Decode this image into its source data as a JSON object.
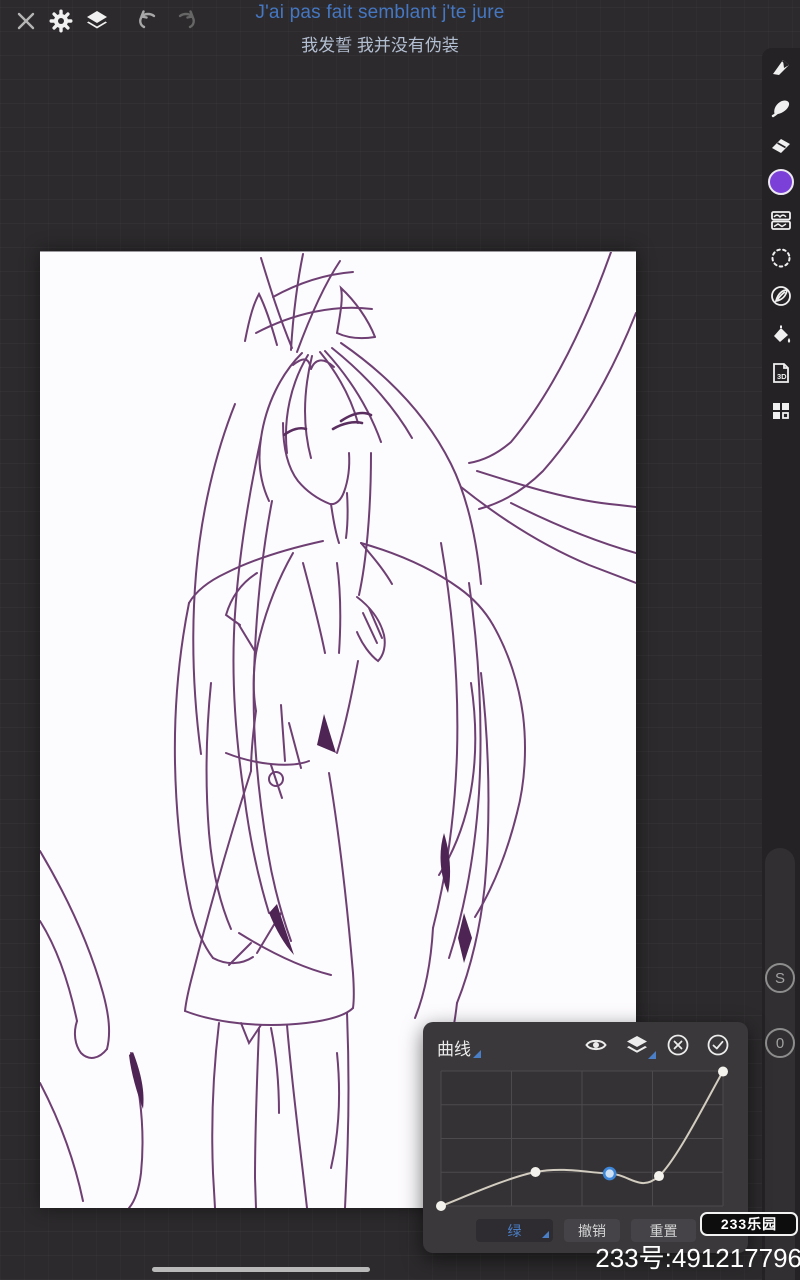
{
  "header": {
    "title_fr": "J'ai pas fait semblant j'te jure",
    "title_zh": "我发誓 我并没有伪装",
    "toolbar_icons": [
      "close-icon",
      "gear-icon",
      "layers-icon",
      "undo-icon",
      "redo-icon"
    ]
  },
  "right_toolbar": {
    "tools": [
      "brush-tool",
      "smudge-tool",
      "eraser-tool",
      "color-swatch",
      "adjustments-tool",
      "lasso-tool",
      "vector-tool",
      "fill-bucket-tool",
      "3d-tool",
      "pixel-grid-tool"
    ],
    "color_swatch_hex": "#7b40d8",
    "stabilizer_label": "S",
    "opacity_label": "0"
  },
  "curves_panel": {
    "title": "曲线",
    "header_icons": [
      "visibility-eye-icon",
      "layers-icon",
      "cancel-icon",
      "confirm-icon"
    ],
    "buttons": {
      "channel": "绿",
      "undo": "撤销",
      "reset": "重置"
    }
  },
  "chart_data": {
    "type": "line",
    "title": "曲线 (tone curve adjustment, green channel)",
    "grid": {
      "cols": 4,
      "rows": 4,
      "on": true
    },
    "x_range": [
      0,
      1
    ],
    "y_range": [
      0,
      1
    ],
    "points": [
      {
        "x": 0.0,
        "y": 0.0,
        "selected": false
      },
      {
        "x": 0.335,
        "y": 0.252,
        "selected": false
      },
      {
        "x": 0.598,
        "y": 0.24,
        "selected": true
      },
      {
        "x": 0.773,
        "y": 0.222,
        "selected": false
      },
      {
        "x": 1.0,
        "y": 0.996,
        "selected": false
      }
    ],
    "curve_color": "#d2cdc0",
    "point_color": "#f4f2ec",
    "selected_point_color": "#3e86d8"
  },
  "watermark": {
    "badge_text": "233乐园",
    "id_text": "233号:491217796"
  },
  "colors": {
    "background": "#2c2a2c",
    "canvas": "#fcfbfd",
    "line_art": "#6e3f73",
    "accent_blue": "#4a7ec7",
    "panel": "#3a383a"
  }
}
